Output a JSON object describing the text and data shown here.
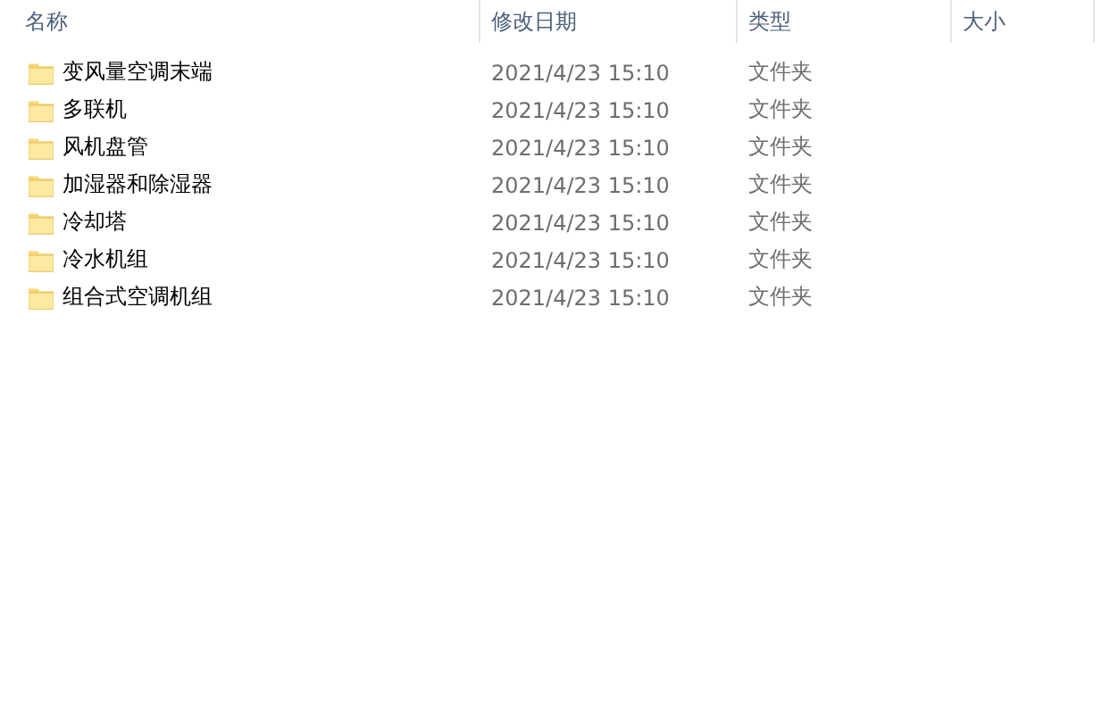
{
  "columns": [
    "名称",
    "修改日期",
    "类型",
    "大小"
  ],
  "rows": [
    {
      "name": "变风量空调末端",
      "modified": "2021/4/23 15:10",
      "type": "文件夹"
    },
    {
      "name": "多联机",
      "modified": "2021/4/23 15:10",
      "type": "文件夹"
    },
    {
      "name": "风机盘管",
      "modified": "2021/4/23 15:10",
      "type": "文件夹"
    },
    {
      "name": "加湿器和除湿器",
      "modified": "2021/4/23 15:10",
      "type": "文件夹"
    },
    {
      "name": "冷却塔",
      "modified": "2021/4/23 15:10",
      "type": "文件夹"
    },
    {
      "name": "冷水机组",
      "modified": "2021/4/23 15:10",
      "type": "文件夹"
    },
    {
      "name": "组合式空调机组",
      "modified": "2021/4/23 15:10",
      "type": "文件夹"
    }
  ]
}
